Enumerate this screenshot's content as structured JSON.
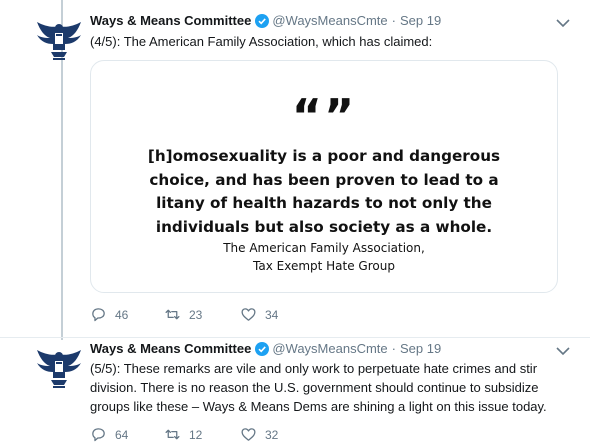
{
  "tweets": [
    {
      "author": "Ways & Means Committee",
      "handle": "@WaysMeansCmte",
      "separator": "·",
      "date": "Sep 19",
      "text": "(4/5): The American Family Association, which has claimed:",
      "card": {
        "quote_mark": "“”",
        "quote_lines": [
          "[h]omosexuality is a poor and dangerous",
          "choice, and has been proven to lead to a",
          "litany of health hazards to not only the",
          "individuals but also society as a whole."
        ],
        "attribution_1": "The American Family Association,",
        "attribution_2": "Tax Exempt Hate Group"
      },
      "replies": "46",
      "retweets": "23",
      "likes": "34"
    },
    {
      "author": "Ways & Means Committee",
      "handle": "@WaysMeansCmte",
      "separator": "·",
      "date": "Sep 19",
      "text": "(5/5): These remarks are vile and only work to perpetuate hate crimes and stir division. There is no reason the U.S. government should continue to subsidize groups like these – Ways & Means Dems are shining a light on this issue today.",
      "replies": "64",
      "retweets": "12",
      "likes": "32"
    }
  ],
  "icons": {
    "avatar": "eagle-seal-icon",
    "verified": "verified-badge-icon",
    "caret": "chevron-down-icon",
    "reply": "reply-icon",
    "retweet": "retweet-icon",
    "like": "heart-icon"
  },
  "colors": {
    "verified": "#1da1f2",
    "avatar": "#1c3a6b",
    "muted": "#657786"
  }
}
